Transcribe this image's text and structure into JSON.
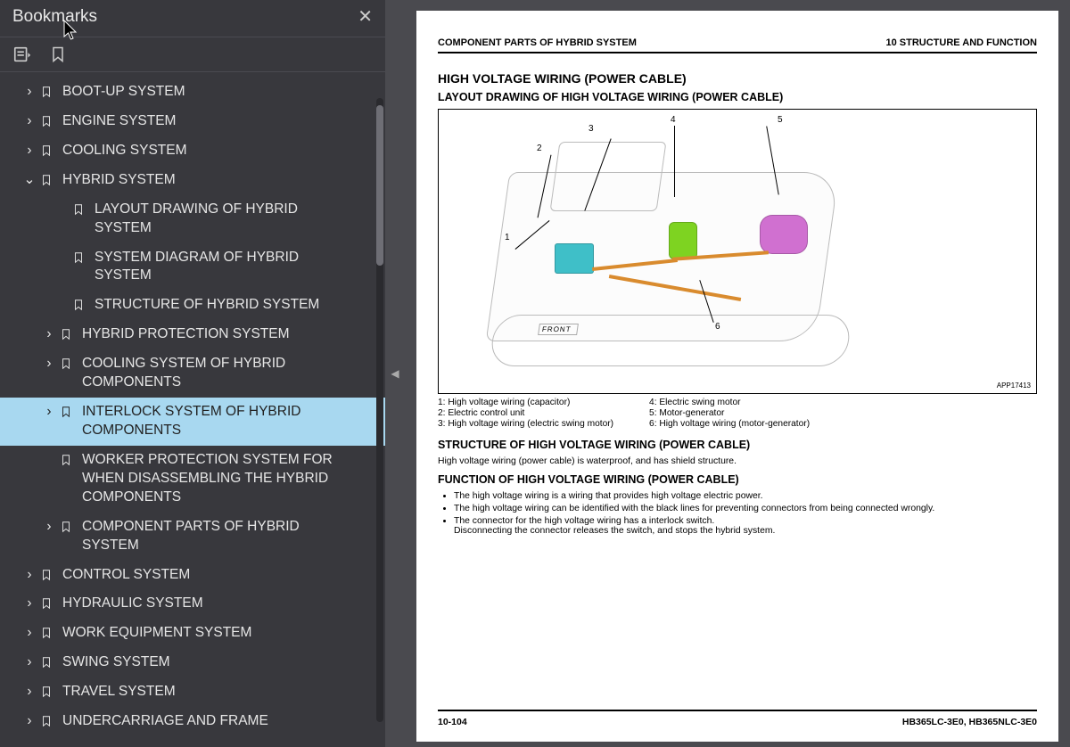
{
  "sidebar": {
    "title": "Bookmarks",
    "nodes": [
      {
        "label": "BOOT-UP SYSTEM",
        "level": 0,
        "hasChildren": true,
        "expanded": false
      },
      {
        "label": "ENGINE SYSTEM",
        "level": 0,
        "hasChildren": true,
        "expanded": false
      },
      {
        "label": "COOLING SYSTEM",
        "level": 0,
        "hasChildren": true,
        "expanded": false
      },
      {
        "label": "HYBRID SYSTEM",
        "level": 0,
        "hasChildren": true,
        "expanded": true
      },
      {
        "label": "LAYOUT DRAWING OF HYBRID SYSTEM",
        "level": 1,
        "hasChildren": false
      },
      {
        "label": "SYSTEM DIAGRAM OF HYBRID SYSTEM",
        "level": 1,
        "hasChildren": false
      },
      {
        "label": "STRUCTURE OF HYBRID SYSTEM",
        "level": 1,
        "hasChildren": false
      },
      {
        "label": "HYBRID PROTECTION SYSTEM",
        "level": 2,
        "hasChildren": true
      },
      {
        "label": "COOLING SYSTEM OF HYBRID COMPONENTS",
        "level": 2,
        "hasChildren": true
      },
      {
        "label": "INTERLOCK SYSTEM OF HYBRID COMPONENTS",
        "level": 2,
        "hasChildren": true,
        "selected": true
      },
      {
        "label": "WORKER PROTECTION SYSTEM FOR WHEN DISASSEMBLING THE HYBRID COMPONENTS",
        "level": 2,
        "hasChildren": false
      },
      {
        "label": "COMPONENT PARTS OF HYBRID SYSTEM",
        "level": 2,
        "hasChildren": true
      },
      {
        "label": "CONTROL SYSTEM",
        "level": 0,
        "hasChildren": true,
        "expanded": false
      },
      {
        "label": "HYDRAULIC SYSTEM",
        "level": 0,
        "hasChildren": true,
        "expanded": false
      },
      {
        "label": "WORK EQUIPMENT SYSTEM",
        "level": 0,
        "hasChildren": true,
        "expanded": false
      },
      {
        "label": "SWING SYSTEM",
        "level": 0,
        "hasChildren": true,
        "expanded": false
      },
      {
        "label": "TRAVEL SYSTEM",
        "level": 0,
        "hasChildren": true,
        "expanded": false
      },
      {
        "label": "UNDERCARRIAGE AND FRAME",
        "level": 0,
        "hasChildren": true,
        "expanded": false
      }
    ]
  },
  "page": {
    "header_left": "COMPONENT PARTS OF HYBRID SYSTEM",
    "header_right": "10 STRUCTURE AND FUNCTION",
    "title1": "HIGH VOLTAGE WIRING (POWER CABLE)",
    "title2": "LAYOUT DRAWING OF HIGH VOLTAGE WIRING (POWER CABLE)",
    "figure_id": "APP17413",
    "front_label": "FRONT",
    "callouts": [
      "1",
      "2",
      "3",
      "4",
      "5",
      "6"
    ],
    "legend_left": [
      "1: High voltage wiring (capacitor)",
      "2: Electric control unit",
      "3: High voltage wiring (electric swing motor)"
    ],
    "legend_right": [
      "4: Electric swing motor",
      "5: Motor-generator",
      "6: High voltage wiring (motor-generator)"
    ],
    "h_struct": "STRUCTURE OF HIGH VOLTAGE WIRING (POWER CABLE)",
    "p_struct": "High voltage wiring (power cable) is waterproof, and has shield structure.",
    "h_func": "FUNCTION OF HIGH VOLTAGE WIRING (POWER CABLE)",
    "bullets": [
      "The high voltage wiring is a wiring that provides high voltage electric power.",
      "The high voltage wiring can be identified with the black lines for preventing connectors from being connected wrongly.",
      "The connector for the high voltage wiring has a interlock switch.\nDisconnecting the connector releases the switch, and stops the hybrid system."
    ],
    "footer_left": "10-104",
    "footer_right": "HB365LC-3E0, HB365NLC-3E0"
  }
}
